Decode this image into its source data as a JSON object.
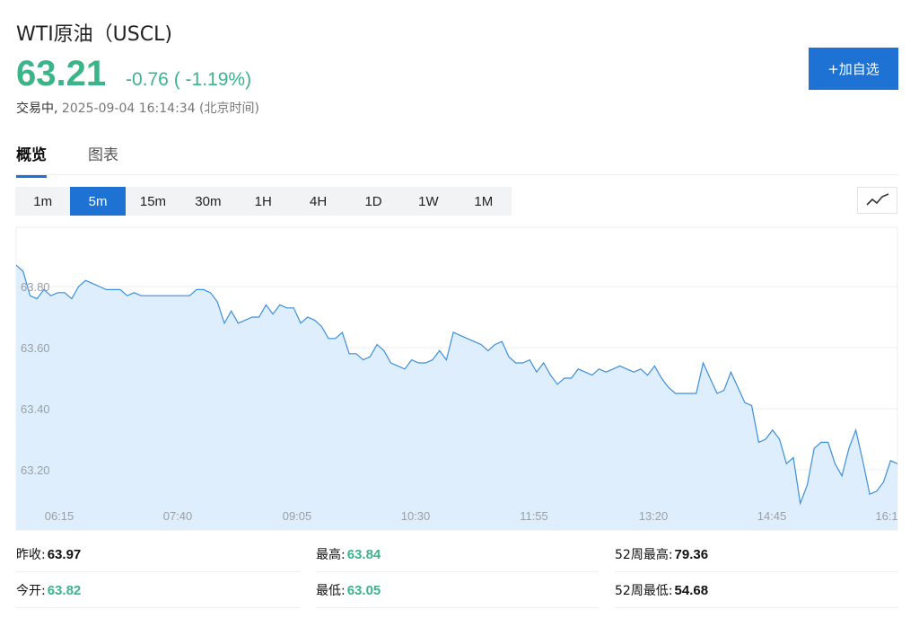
{
  "header": {
    "title": "WTI原油（USCL)",
    "price": "63.21",
    "change": "-0.76 ( -1.19%)",
    "status_label": "交易中,",
    "timestamp": "2025-09-04 16:14:34 (北京时间)",
    "add_button": "+加自选"
  },
  "tabs": [
    {
      "label": "概览",
      "active": true
    },
    {
      "label": "图表",
      "active": false
    }
  ],
  "intervals": [
    {
      "label": "1m",
      "active": false
    },
    {
      "label": "5m",
      "active": true
    },
    {
      "label": "15m",
      "active": false
    },
    {
      "label": "30m",
      "active": false
    },
    {
      "label": "1H",
      "active": false
    },
    {
      "label": "4H",
      "active": false
    },
    {
      "label": "1D",
      "active": false
    },
    {
      "label": "1W",
      "active": false
    },
    {
      "label": "1M",
      "active": false
    }
  ],
  "chart_type_icon": "line-chart-icon",
  "colors": {
    "up_down_green": "#3cb48a",
    "accent_blue": "#1e72d3",
    "area_fill": "#deeefc",
    "line": "#3d8fdc"
  },
  "chart_data": {
    "type": "area",
    "title": "",
    "xlabel": "",
    "ylabel": "",
    "x_tick_labels": [
      "06:15",
      "07:40",
      "09:05",
      "10:30",
      "11:55",
      "13:20",
      "14:45",
      "16:1"
    ],
    "y_tick_labels": [
      "63.80",
      "63.60",
      "63.40",
      "63.20"
    ],
    "y_ticks": [
      63.8,
      63.6,
      63.4,
      63.2
    ],
    "ylim": [
      63.0,
      64.0
    ],
    "grid": true,
    "series": [
      {
        "values": [
          63.87,
          63.85,
          63.77,
          63.76,
          63.79,
          63.77,
          63.78,
          63.78,
          63.76,
          63.8,
          63.82,
          63.81,
          63.8,
          63.79,
          63.79,
          63.79,
          63.77,
          63.78,
          63.77,
          63.77,
          63.77,
          63.77,
          63.77,
          63.77,
          63.77,
          63.77,
          63.79,
          63.79,
          63.78,
          63.75,
          63.68,
          63.72,
          63.68,
          63.69,
          63.7,
          63.7,
          63.74,
          63.71,
          63.74,
          63.73,
          63.73,
          63.68,
          63.7,
          63.69,
          63.67,
          63.63,
          63.63,
          63.65,
          63.58,
          63.58,
          63.56,
          63.57,
          63.61,
          63.59,
          63.55,
          63.54,
          63.53,
          63.56,
          63.55,
          63.55,
          63.56,
          63.59,
          63.56,
          63.65,
          63.64,
          63.63,
          63.62,
          63.61,
          63.59,
          63.61,
          63.62,
          63.57,
          63.55,
          63.55,
          63.56,
          63.52,
          63.55,
          63.51,
          63.48,
          63.5,
          63.5,
          63.53,
          63.52,
          63.51,
          63.53,
          63.52,
          63.53,
          63.54,
          63.53,
          63.52,
          63.53,
          63.51,
          63.54,
          63.5,
          63.47,
          63.45,
          63.45,
          63.45,
          63.45,
          63.55,
          63.5,
          63.45,
          63.46,
          63.52,
          63.47,
          63.42,
          63.41,
          63.29,
          63.3,
          63.33,
          63.3,
          63.22,
          63.24,
          63.09,
          63.15,
          63.27,
          63.29,
          63.29,
          63.22,
          63.18,
          63.27,
          63.33,
          63.23,
          63.12,
          63.13,
          63.16,
          63.23,
          63.22
        ]
      }
    ]
  },
  "stats": [
    {
      "label": "昨收:",
      "value": "63.97",
      "tone": "dark"
    },
    {
      "label": "最高:",
      "value": "63.84",
      "tone": "green"
    },
    {
      "label": "52周最高:",
      "value": "79.36",
      "tone": "dark"
    },
    {
      "label": "今开:",
      "value": "63.82",
      "tone": "green"
    },
    {
      "label": "最低:",
      "value": "63.05",
      "tone": "green"
    },
    {
      "label": "52周最低:",
      "value": "54.68",
      "tone": "dark"
    }
  ]
}
